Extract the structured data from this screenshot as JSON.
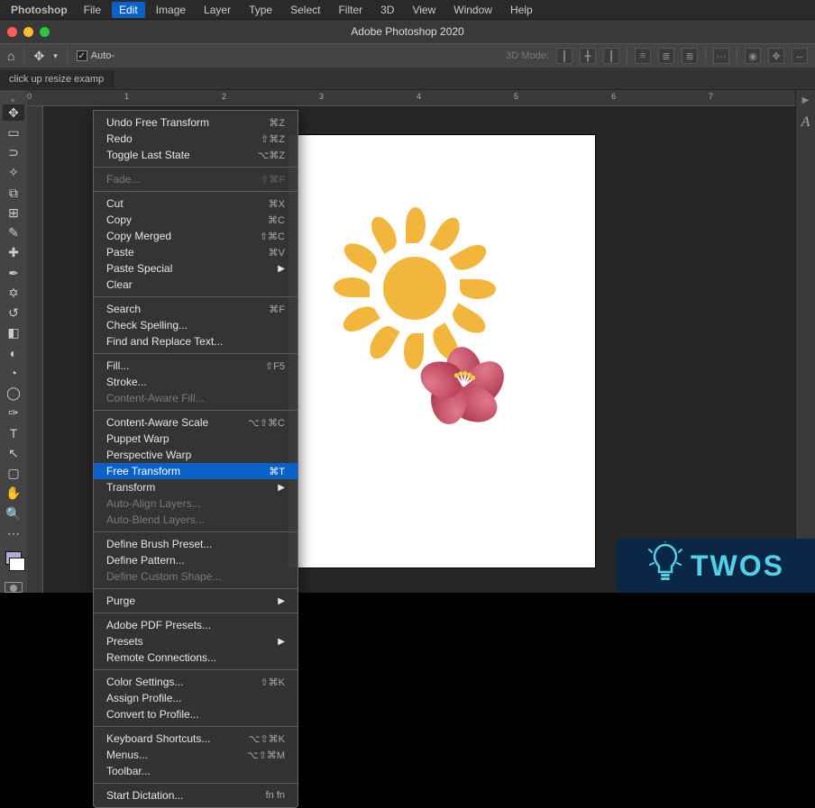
{
  "menubar": {
    "app": "Photoshop",
    "items": [
      "File",
      "Edit",
      "Image",
      "Layer",
      "Type",
      "Select",
      "Filter",
      "3D",
      "View",
      "Window",
      "Help"
    ],
    "active": "Edit"
  },
  "titlebar": {
    "title": "Adobe Photoshop 2020"
  },
  "optbar": {
    "auto_label": "Auto-",
    "mode_label": "3D Mode:"
  },
  "tabbar": {
    "tab0": "click up resize examp"
  },
  "ruler": {
    "ticks": [
      "0",
      "1",
      "2",
      "3",
      "4",
      "5",
      "6",
      "7"
    ]
  },
  "dropdown": {
    "groups": [
      [
        {
          "label": "Undo Free Transform",
          "short": "⌘Z",
          "enabled": true
        },
        {
          "label": "Redo",
          "short": "⇧⌘Z",
          "enabled": true
        },
        {
          "label": "Toggle Last State",
          "short": "⌥⌘Z",
          "enabled": true
        }
      ],
      [
        {
          "label": "Fade...",
          "short": "⇧⌘F",
          "enabled": false
        }
      ],
      [
        {
          "label": "Cut",
          "short": "⌘X",
          "enabled": true
        },
        {
          "label": "Copy",
          "short": "⌘C",
          "enabled": true
        },
        {
          "label": "Copy Merged",
          "short": "⇧⌘C",
          "enabled": true
        },
        {
          "label": "Paste",
          "short": "⌘V",
          "enabled": true
        },
        {
          "label": "Paste Special",
          "short": "▶",
          "enabled": true,
          "submenu": true
        },
        {
          "label": "Clear",
          "short": "",
          "enabled": true
        }
      ],
      [
        {
          "label": "Search",
          "short": "⌘F",
          "enabled": true
        },
        {
          "label": "Check Spelling...",
          "short": "",
          "enabled": true
        },
        {
          "label": "Find and Replace Text...",
          "short": "",
          "enabled": true
        }
      ],
      [
        {
          "label": "Fill...",
          "short": "⇧F5",
          "enabled": true
        },
        {
          "label": "Stroke...",
          "short": "",
          "enabled": true
        },
        {
          "label": "Content-Aware Fill...",
          "short": "",
          "enabled": false
        }
      ],
      [
        {
          "label": "Content-Aware Scale",
          "short": "⌥⇧⌘C",
          "enabled": true
        },
        {
          "label": "Puppet Warp",
          "short": "",
          "enabled": true
        },
        {
          "label": "Perspective Warp",
          "short": "",
          "enabled": true
        },
        {
          "label": "Free Transform",
          "short": "⌘T",
          "enabled": true,
          "highlight": true
        },
        {
          "label": "Transform",
          "short": "▶",
          "enabled": true,
          "submenu": true
        },
        {
          "label": "Auto-Align Layers...",
          "short": "",
          "enabled": false
        },
        {
          "label": "Auto-Blend Layers...",
          "short": "",
          "enabled": false
        }
      ],
      [
        {
          "label": "Define Brush Preset...",
          "short": "",
          "enabled": true
        },
        {
          "label": "Define Pattern...",
          "short": "",
          "enabled": true
        },
        {
          "label": "Define Custom Shape...",
          "short": "",
          "enabled": false
        }
      ],
      [
        {
          "label": "Purge",
          "short": "▶",
          "enabled": true,
          "submenu": true
        }
      ],
      [
        {
          "label": "Adobe PDF Presets...",
          "short": "",
          "enabled": true
        },
        {
          "label": "Presets",
          "short": "▶",
          "enabled": true,
          "submenu": true
        },
        {
          "label": "Remote Connections...",
          "short": "",
          "enabled": true
        }
      ],
      [
        {
          "label": "Color Settings...",
          "short": "⇧⌘K",
          "enabled": true
        },
        {
          "label": "Assign Profile...",
          "short": "",
          "enabled": true
        },
        {
          "label": "Convert to Profile...",
          "short": "",
          "enabled": true
        }
      ],
      [
        {
          "label": "Keyboard Shortcuts...",
          "short": "⌥⇧⌘K",
          "enabled": true
        },
        {
          "label": "Menus...",
          "short": "⌥⇧⌘M",
          "enabled": true
        },
        {
          "label": "Toolbar...",
          "short": "",
          "enabled": true
        }
      ],
      [
        {
          "label": "Start Dictation...",
          "short": "fn fn",
          "enabled": true
        }
      ]
    ]
  },
  "tools": [
    {
      "name": "move-tool",
      "glyph": "✥",
      "selected": true
    },
    {
      "name": "marquee-tool",
      "glyph": "▭"
    },
    {
      "name": "lasso-tool",
      "glyph": "⊃"
    },
    {
      "name": "magic-wand-tool",
      "glyph": "✧"
    },
    {
      "name": "crop-tool",
      "glyph": "⧉"
    },
    {
      "name": "frame-tool",
      "glyph": "⊞"
    },
    {
      "name": "eyedropper-tool",
      "glyph": "✎"
    },
    {
      "name": "healing-brush-tool",
      "glyph": "✚"
    },
    {
      "name": "brush-tool",
      "glyph": "✒"
    },
    {
      "name": "clone-stamp-tool",
      "glyph": "✡"
    },
    {
      "name": "history-brush-tool",
      "glyph": "↺"
    },
    {
      "name": "eraser-tool",
      "glyph": "◧"
    },
    {
      "name": "gradient-tool",
      "glyph": "◐"
    },
    {
      "name": "blur-tool",
      "glyph": "◔"
    },
    {
      "name": "dodge-tool",
      "glyph": "◯"
    },
    {
      "name": "pen-tool",
      "glyph": "✑"
    },
    {
      "name": "type-tool",
      "glyph": "T"
    },
    {
      "name": "path-selection-tool",
      "glyph": "↖"
    },
    {
      "name": "rectangle-tool",
      "glyph": "▢"
    },
    {
      "name": "hand-tool",
      "glyph": "✋"
    },
    {
      "name": "zoom-tool",
      "glyph": "🔍"
    },
    {
      "name": "edit-toolbar",
      "glyph": "⋯"
    }
  ],
  "rightpanel": {
    "icons": [
      "▶",
      "A"
    ]
  },
  "watermark": {
    "text": "TWOS"
  }
}
